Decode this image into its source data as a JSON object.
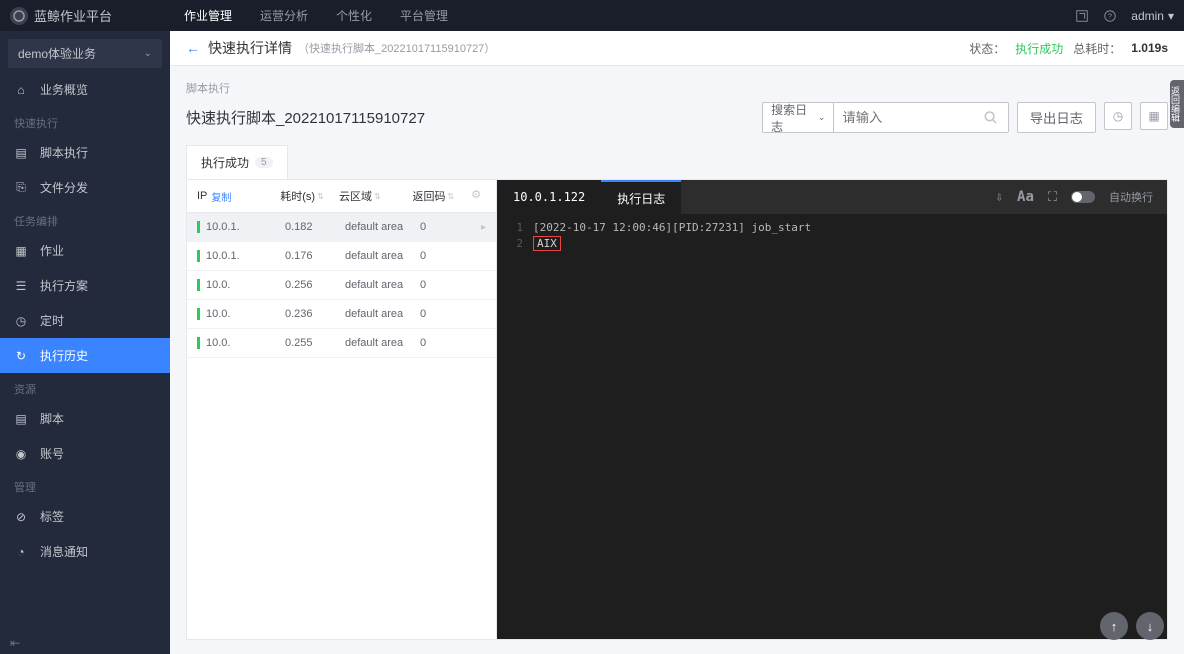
{
  "header": {
    "platform_name": "蓝鲸作业平台",
    "nav": [
      "作业管理",
      "运营分析",
      "个性化",
      "平台管理"
    ],
    "user": "admin"
  },
  "sidebar": {
    "biz": "demo体验业务",
    "overview": "业务概览",
    "groups": [
      {
        "label": "快速执行",
        "items": [
          {
            "icon": "script",
            "label": "脚本执行"
          },
          {
            "icon": "file",
            "label": "文件分发"
          }
        ]
      },
      {
        "label": "任务编排",
        "items": [
          {
            "icon": "job",
            "label": "作业"
          },
          {
            "icon": "plan",
            "label": "执行方案"
          },
          {
            "icon": "cron",
            "label": "定时"
          },
          {
            "icon": "history",
            "label": "执行历史",
            "active": true
          }
        ]
      },
      {
        "label": "资源",
        "items": [
          {
            "icon": "code",
            "label": "脚本"
          },
          {
            "icon": "account",
            "label": "账号"
          }
        ]
      },
      {
        "label": "管理",
        "items": [
          {
            "icon": "tag",
            "label": "标签"
          },
          {
            "icon": "bell",
            "label": "消息通知"
          }
        ]
      }
    ]
  },
  "page_header": {
    "title": "快速执行详情",
    "sub": "（快速执行脚本_20221017115910727）",
    "status_label": "状态：",
    "status_value": "执行成功",
    "time_label": "总耗时：",
    "time_value": "1.019s"
  },
  "content": {
    "breadcrumb": "脚本执行",
    "task_name": "快速执行脚本_20221017115910727",
    "search_type": "搜索日志",
    "search_placeholder": "请输入",
    "export_btn": "导出日志",
    "tab_label": "执行成功",
    "tab_count": "5"
  },
  "table": {
    "cols": {
      "ip": "IP",
      "copy": "复制",
      "time": "耗时(s)",
      "area": "云区域",
      "code": "返回码"
    },
    "rows": [
      {
        "ip": "10.0.1.",
        "time": "0.182",
        "area": "default area",
        "code": "0",
        "selected": true
      },
      {
        "ip": "10.0.1.",
        "time": "0.176",
        "area": "default area",
        "code": "0"
      },
      {
        "ip": "10.0.",
        "time": "0.256",
        "area": "default area",
        "code": "0"
      },
      {
        "ip": "10.0.",
        "time": "0.236",
        "area": "default area",
        "code": "0"
      },
      {
        "ip": "10.0.",
        "time": "0.255",
        "area": "default area",
        "code": "0"
      }
    ]
  },
  "log": {
    "ip": "10.0.1.122",
    "tab": "执行日志",
    "autowrap": "自动换行",
    "lines": [
      "[2022-10-17 12:00:46][PID:27231] job_start",
      "AIX"
    ]
  },
  "side_strip": "返回编辑",
  "icons": {
    "home": "⌂",
    "script": "▤",
    "file": "⎘",
    "job": "▦",
    "plan": "☰",
    "cron": "◷",
    "history": "↻",
    "code": "▤",
    "account": "◉",
    "tag": "⊘",
    "bell": "◔"
  }
}
